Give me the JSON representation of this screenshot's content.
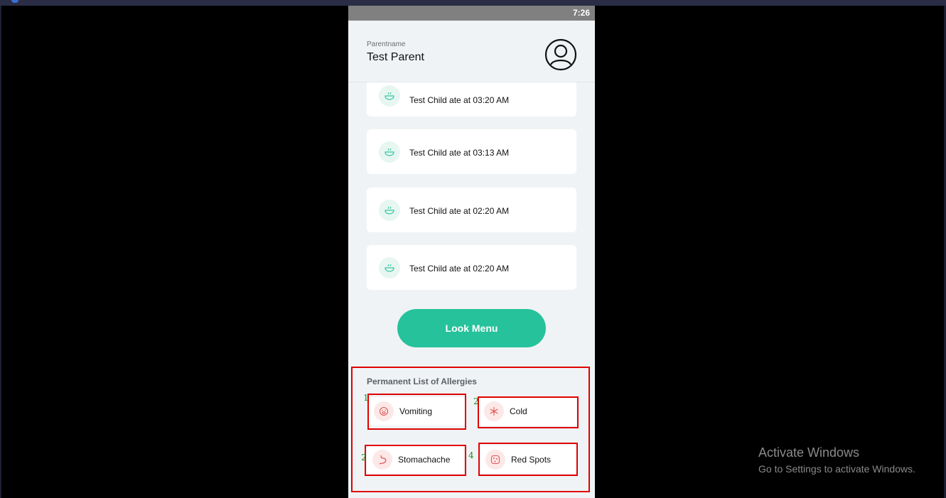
{
  "status_bar": {
    "time": "7:26"
  },
  "header": {
    "caption": "Parentname",
    "name": "Test Parent",
    "avatar_icon": "user-circle-icon"
  },
  "feed": {
    "icon": "food-bowl-icon",
    "items": [
      {
        "text": "Test Child ate at 03:20 AM"
      },
      {
        "text": "Test Child ate at 03:13 AM"
      },
      {
        "text": "Test Child ate at 02:20 AM"
      },
      {
        "text": "Test Child ate at 02:20 AM"
      }
    ]
  },
  "look_menu_button": {
    "label": "Look Menu"
  },
  "allergies": {
    "title": "Permanent List of Allergies",
    "items": [
      {
        "label": "Vomiting",
        "icon": "vomit-face-icon",
        "marker": "1"
      },
      {
        "label": "Cold",
        "icon": "snowflake-icon",
        "marker": "2"
      },
      {
        "label": "Stomachache",
        "icon": "stomach-icon",
        "marker": "2"
      },
      {
        "label": "Red Spots",
        "icon": "red-spots-icon",
        "marker": "4"
      }
    ]
  },
  "watermark": {
    "title": "Activate Windows",
    "subtitle": "Go to Settings to activate Windows."
  },
  "colors": {
    "accent": "#26c29b",
    "annotation": "#e00000",
    "background": "#f0f3f5"
  }
}
